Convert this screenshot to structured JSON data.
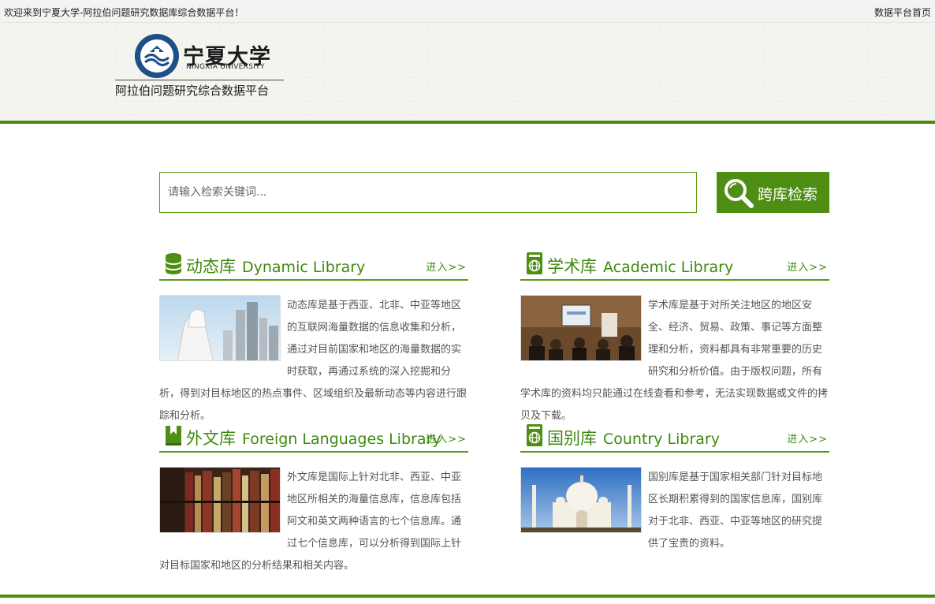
{
  "topbar": {
    "welcome": "欢迎来到宁夏大学-阿拉伯问题研究数据库综合数据平台！",
    "home_link": "数据平台首页"
  },
  "header": {
    "logo_cn": "宁夏大学",
    "logo_en": "NINGXIA UNIVERSITY",
    "platform_name": "阿拉伯问题研究综合数据平台"
  },
  "search": {
    "placeholder": "请输入检索关键词...",
    "button_label": "跨库检索"
  },
  "libraries": {
    "dynamic": {
      "title_cn": "动态库",
      "title_en": "Dynamic Library",
      "enter": "进入>>",
      "icon": "database-icon",
      "description": "动态库是基于西亚、北非、中亚等地区的互联网海量数据的信息收集和分析，通过对目前国家和地区的海量数据的实时获取，再通过系统的深入挖掘和分析，得到对目标地区的热点事件、区域组织及最新动态等内容进行跟踪和分析。"
    },
    "academic": {
      "title_cn": "学术库",
      "title_en": "Academic Library",
      "enter": "进入>>",
      "icon": "globe-book-icon",
      "description": "学术库是基于对所关注地区的地区安全、经济、贸易、政策、事记等方面整理和分析，资料都具有非常重要的历史研究和分析价值。由于版权问题，所有学术库的资料均只能通过在线查看和参考，无法实现数据或文件的拷贝及下载。"
    },
    "foreign": {
      "title_cn": "外文库",
      "title_en": "Foreign Languages Library",
      "enter": "进入>>",
      "icon": "book-icon",
      "description": "外文库是国际上针对北非、西亚、中亚地区所相关的海量信息库，信息库包括阿文和英文两种语言的七个信息库。通过七个信息库，可以分析得到国际上针对目标国家和地区的分析结果和相关内容。"
    },
    "country": {
      "title_cn": "国别库",
      "title_en": "Country Library",
      "enter": "进入>>",
      "icon": "globe-book-icon",
      "description": "国别库是基于国家相关部门针对目标地区长期积累得到的国家信息库，国别库对于北非、西亚、中亚等地区的研究提供了宝贵的资料。"
    }
  },
  "colors": {
    "brand_green": "#4f8a10",
    "title_green": "#3e8a0e"
  }
}
